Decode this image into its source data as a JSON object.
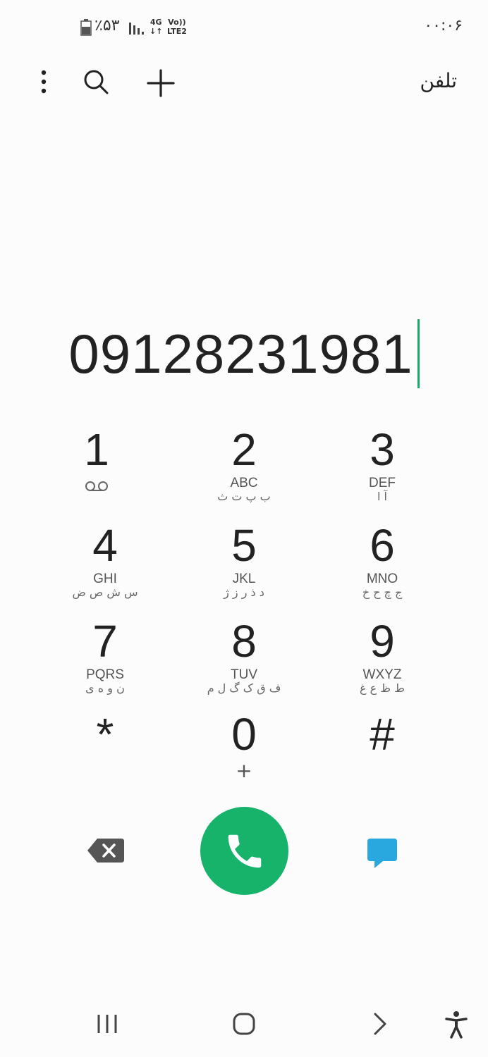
{
  "status_bar": {
    "clock": "۰۰:۰۶",
    "battery": "٪۵۳",
    "network_type": "4G",
    "volte": "Vo))",
    "lte": "LTE2"
  },
  "header": {
    "title": "تلفن",
    "icons": [
      "more-options-icon",
      "search-icon",
      "add-icon"
    ]
  },
  "dialer": {
    "number": "09128231981"
  },
  "keypad": [
    {
      "digit": "1",
      "letters": "",
      "persian": "",
      "sub": "voicemail-icon"
    },
    {
      "digit": "2",
      "letters": "ABC",
      "persian": "ب پ ت ث"
    },
    {
      "digit": "3",
      "letters": "DEF",
      "persian": "آ ا"
    },
    {
      "digit": "4",
      "letters": "GHI",
      "persian": "س ش ص ض"
    },
    {
      "digit": "5",
      "letters": "JKL",
      "persian": "د ذ ر ز ژ"
    },
    {
      "digit": "6",
      "letters": "MNO",
      "persian": "ج چ ح خ"
    },
    {
      "digit": "7",
      "letters": "PQRS",
      "persian": "ن و ه ی"
    },
    {
      "digit": "8",
      "letters": "TUV",
      "persian": "ف ق ک گ ل م"
    },
    {
      "digit": "9",
      "letters": "WXYZ",
      "persian": "ط ظ ع غ"
    },
    {
      "digit": "*",
      "letters": "",
      "persian": ""
    },
    {
      "digit": "0",
      "letters": "",
      "persian": "",
      "sub": "+"
    },
    {
      "digit": "#",
      "letters": "",
      "persian": ""
    }
  ],
  "actions": {
    "icons": [
      "backspace-icon",
      "call-icon",
      "message-icon"
    ],
    "call_color": "#17b36b",
    "message_color": "#29a8e0"
  },
  "nav": {
    "icons": [
      "recents-icon",
      "home-icon",
      "back-icon",
      "accessibility-icon"
    ]
  }
}
